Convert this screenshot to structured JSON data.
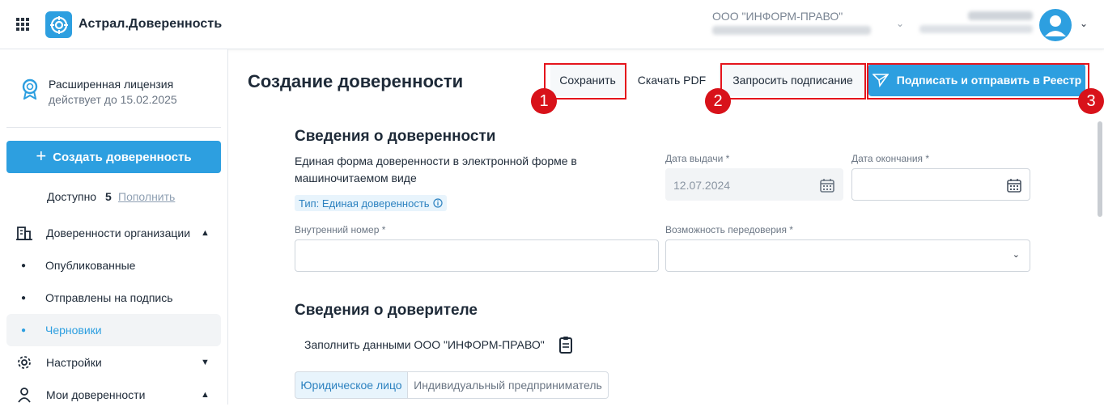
{
  "header": {
    "app_title": "Астрал.Доверенность",
    "org_name": "ООО \"ИНФОРМ-ПРАВО\""
  },
  "sidebar": {
    "license_title": "Расширенная лицензия",
    "license_valid": "действует до 15.02.2025",
    "create_button": "Создать доверенность",
    "available_label": "Доступно",
    "available_count": "5",
    "replenish_link": "Пополнить",
    "nav": {
      "org_poa": "Доверенности организации",
      "published": "Опубликованные",
      "sent_for_signing": "Отправлены на подпись",
      "drafts": "Черновики",
      "settings": "Настройки",
      "my_poa": "Мои доверенности"
    }
  },
  "toolbar": {
    "page_title": "Создание доверенности",
    "save": "Сохранить",
    "download_pdf": "Скачать PDF",
    "request_signing": "Запросить подписание",
    "sign_and_send": "Подписать и отправить в Реестр",
    "badges": [
      "1",
      "2",
      "3"
    ]
  },
  "poa_section": {
    "title": "Сведения о доверенности",
    "description": "Единая форма доверенности в электронной форме в машиночитаемом виде",
    "type_chip": "Тип: Единая доверенность",
    "issue_date_label": "Дата выдачи *",
    "issue_date_value": "12.07.2024",
    "end_date_label": "Дата окончания *",
    "end_date_value": "",
    "internal_number_label": "Внутренний номер *",
    "internal_number_value": "",
    "redelegation_label": "Возможность передоверия *",
    "redelegation_value": ""
  },
  "principal_section": {
    "title": "Сведения о доверителе",
    "fill_with": "Заполнить данными ООО \"ИНФОРМ-ПРАВО\"",
    "tabs": [
      "Юридическое лицо",
      "Индивидуальный предприниматель"
    ]
  },
  "colors": {
    "accent": "#2d9fe0",
    "highlight": "#e5141c",
    "text": "#1e2a38"
  }
}
